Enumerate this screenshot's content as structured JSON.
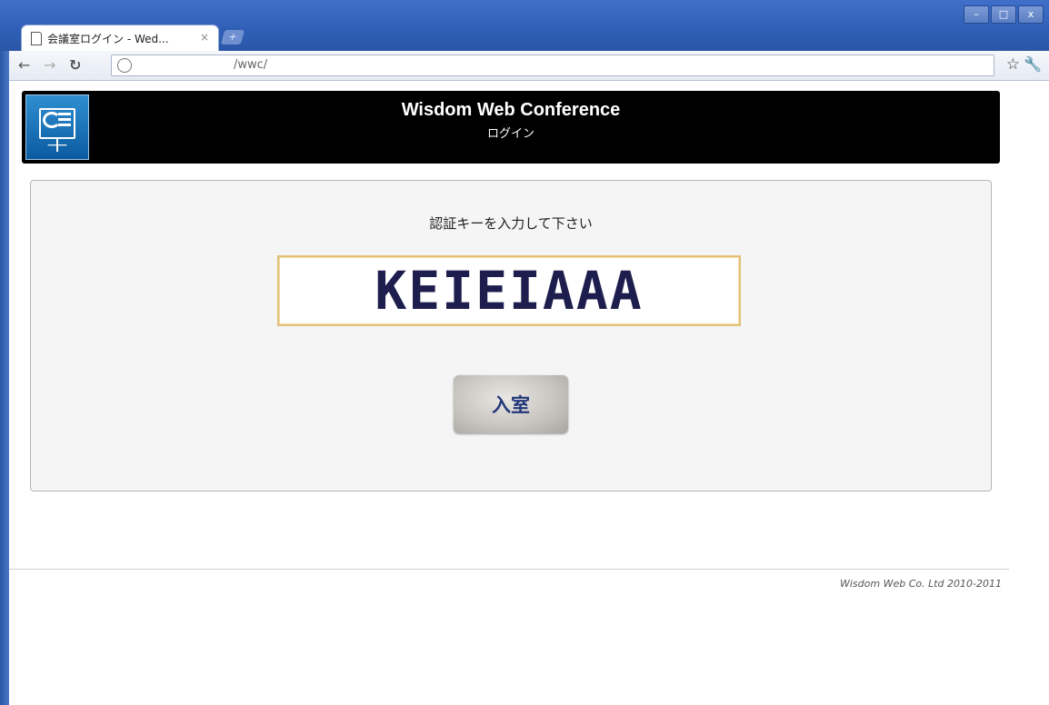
{
  "browser": {
    "tab_title": "会議室ログイン - Wed...",
    "tab_close": "×",
    "new_tab": "+",
    "url": "/wwc/",
    "window_controls": [
      "–",
      "□",
      "x"
    ]
  },
  "header": {
    "title": "Wisdom Web Conference",
    "subtitle": "ログイン"
  },
  "login": {
    "prompt": "認証キーを入力して下さい",
    "key_value": "KEIEIAAA",
    "enter_button": "入室"
  },
  "footer": {
    "copyright": "Wisdom Web Co. Ltd 2010-2011"
  },
  "colors": {
    "header_bg": "#000000",
    "input_border": "#e3c17a",
    "button_text": "#22367a"
  }
}
